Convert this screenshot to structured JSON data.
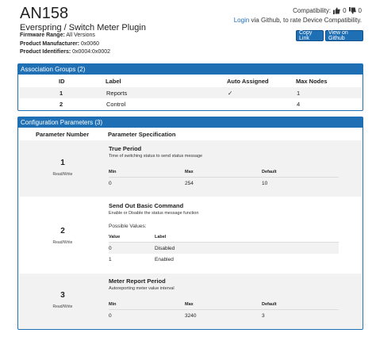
{
  "device": {
    "title": "AN158",
    "subtitle": "Everspring / Switch Meter Plugin",
    "firmware_label": "Firmware Range:",
    "firmware_value": "All Versions",
    "manufacturer_label": "Product Manufacturer:",
    "manufacturer_value": "0x0060",
    "identifiers_label": "Product Identifiers:",
    "identifiers_value": "0x0004:0x0002"
  },
  "compat": {
    "label": "Compatibility:",
    "up_count": "0",
    "down_count": "0",
    "login_link": "Login",
    "login_rest": "via Github, to rate Device Compatibility."
  },
  "buttons": {
    "copy_link": "Copy Link",
    "view_github": "View on Github"
  },
  "colors": {
    "accent": "#1f6fb5"
  },
  "association": {
    "title": "Association Groups (2)",
    "headers": {
      "id": "ID",
      "label": "Label",
      "auto": "Auto Assigned",
      "max": "Max Nodes"
    },
    "rows": [
      {
        "id": "1",
        "label": "Reports",
        "auto": "✓",
        "max": "1"
      },
      {
        "id": "2",
        "label": "Control",
        "auto": "",
        "max": "4"
      }
    ]
  },
  "config": {
    "title": "Configuration Parameters (3)",
    "headers": {
      "number": "Parameter Number",
      "spec": "Parameter Specification"
    },
    "params": [
      {
        "number": "1",
        "access": "Read/Write",
        "name": "True Period",
        "desc": "Time of switching status to send status message",
        "h_min": "Min",
        "h_max": "Max",
        "h_default": "Default",
        "min": "0",
        "max": "254",
        "default": "10"
      },
      {
        "number": "2",
        "access": "Read/Write",
        "name": "Send Out Basic Command",
        "desc": "Enable or Disable the status message function",
        "possible_label": "Possible Values:",
        "h_value": "Value",
        "h_label": "Label",
        "values": [
          {
            "value": "0",
            "label": "Disabled"
          },
          {
            "value": "1",
            "label": "Enabled"
          }
        ]
      },
      {
        "number": "3",
        "access": "Read/Write",
        "name": "Meter Report Period",
        "desc": "Autoreporting meter value interval",
        "h_min": "Min",
        "h_max": "Max",
        "h_default": "Default",
        "min": "0",
        "max": "3240",
        "default": "3"
      }
    ]
  }
}
